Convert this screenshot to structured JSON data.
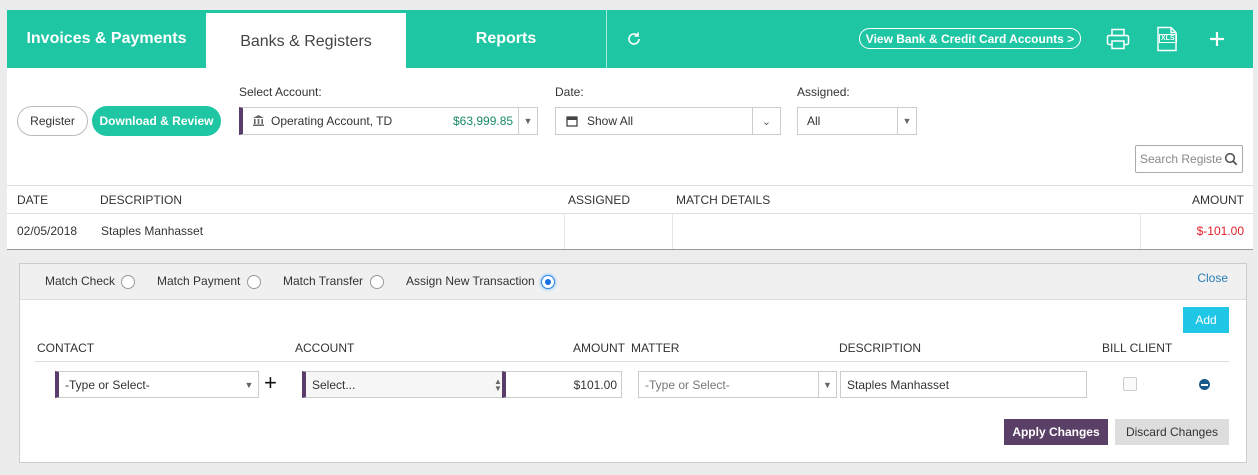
{
  "tabs": [
    {
      "label": "Invoices & Payments",
      "active": false
    },
    {
      "label": "Banks & Registers",
      "active": true
    },
    {
      "label": "Reports",
      "active": false
    }
  ],
  "topbar": {
    "refresh_icon": "refresh-icon",
    "view_accounts_label": "View Bank & Credit Card Accounts >",
    "print_icon": "print-icon",
    "xls_icon": "xls-icon",
    "xls_text": "XLS",
    "add_icon": "plus-icon"
  },
  "toolbar": {
    "register_label": "Register",
    "download_label": "Download & Review"
  },
  "filters": {
    "account_label": "Select Account:",
    "account_value": "Operating Account, TD",
    "account_balance": "$63,999.85",
    "date_label": "Date:",
    "date_value": "Show All",
    "assigned_label": "Assigned:",
    "assigned_value": "All"
  },
  "search": {
    "placeholder": "Search Registe"
  },
  "table": {
    "columns": [
      "DATE",
      "DESCRIPTION",
      "ASSIGNED",
      "MATCH DETAILS",
      "AMOUNT"
    ],
    "rows": [
      {
        "date": "02/05/2018",
        "description": "Staples Manhasset",
        "assigned": "",
        "match_details": "",
        "amount": "$-101.00"
      }
    ]
  },
  "match_panel": {
    "options": [
      {
        "label": "Match Check",
        "selected": false
      },
      {
        "label": "Match Payment",
        "selected": false
      },
      {
        "label": "Match Transfer",
        "selected": false
      },
      {
        "label": "Assign New Transaction",
        "selected": true
      }
    ],
    "close_label": "Close",
    "add_label": "Add",
    "columns": {
      "contact": "CONTACT",
      "account": "ACCOUNT",
      "amount": "AMOUNT",
      "matter": "MATTER",
      "description": "DESCRIPTION",
      "bill_client": "BILL CLIENT"
    },
    "line": {
      "contact_placeholder": "-Type or Select-",
      "account_value": "Select...",
      "amount": "$101.00",
      "matter_placeholder": "-Type or Select-",
      "description": "Staples Manhasset",
      "bill_client": false
    },
    "apply_label": "Apply Changes",
    "discard_label": "Discard Changes"
  },
  "colors": {
    "brand": "#1fc6a4",
    "negative_amount": "#e0202a",
    "balance": "#1a8a6a",
    "accent_purple": "#5a4066",
    "add_button": "#1fc6e6"
  }
}
